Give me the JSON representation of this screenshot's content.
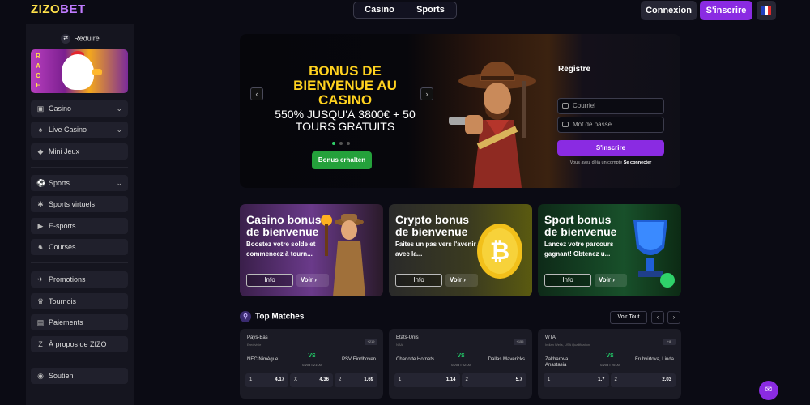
{
  "header": {
    "logo_part1": "ZIZO",
    "logo_part2": "BET",
    "tabs": [
      "Casino",
      "Sports"
    ],
    "login_label": "Connexion",
    "signup_label": "S'inscrire"
  },
  "sidebar": {
    "collapse_label": "Réduire",
    "race_banner_text": "RACE",
    "group1": [
      {
        "label": "Casino",
        "icon": "slot-icon",
        "has_chevron": true
      },
      {
        "label": "Live Casino",
        "icon": "cards-icon",
        "has_chevron": true
      },
      {
        "label": "Mini Jeux",
        "icon": "diamond-icon",
        "has_chevron": false
      }
    ],
    "group2": [
      {
        "label": "Sports",
        "icon": "ball-icon",
        "has_chevron": true
      },
      {
        "label": "Sports virtuels",
        "icon": "virtual-ball-icon",
        "has_chevron": false
      },
      {
        "label": "E-sports",
        "icon": "gamepad-icon",
        "has_chevron": false
      },
      {
        "label": "Courses",
        "icon": "horse-icon",
        "has_chevron": false
      }
    ],
    "group3": [
      {
        "label": "Promotions",
        "icon": "megaphone-icon"
      },
      {
        "label": "Tournois",
        "icon": "trophy-icon"
      },
      {
        "label": "Paiements",
        "icon": "wallet-icon"
      },
      {
        "label": "À propos de ZIZO",
        "icon": "zizo-icon"
      }
    ],
    "support_label": "Soutien"
  },
  "hero": {
    "title": "BONUS DE BIENVENUE AU CASINO",
    "subtitle": "550% JUSQU'À 3800€ + 50 TOURS GRATUITS",
    "button_label": "Bonus erhalten"
  },
  "register": {
    "title": "Registre",
    "email_placeholder": "Courriel",
    "password_placeholder": "Mot de passe",
    "submit_label": "S'inscrire",
    "footer_text": "Vous avez déjà un compte",
    "footer_link": "Se connecter"
  },
  "promos": [
    {
      "title": "Casino bonus de bienvenue",
      "desc": "Boostez votre solde et commencez à tourn...",
      "info": "Info",
      "voir": "Voir"
    },
    {
      "title": "Crypto bonus de bienvenue",
      "desc": "Faites un pas vers l'avenir avec la...",
      "info": "Info",
      "voir": "Voir"
    },
    {
      "title": "Sport bonus de bienvenue",
      "desc": "Lancez votre parcours gagnant! Obtenez u...",
      "info": "Info",
      "voir": "Voir"
    }
  ],
  "matches": {
    "heading": "Top Matches",
    "voir_tout": "Voir Tout",
    "cards": [
      {
        "league": "Pays-Bas",
        "sub": "Eredivisie",
        "badge": "+219",
        "team1": "NEC Nimègue",
        "team2": "PSV Eindhoven",
        "vs": "VS",
        "time": "03/03 • 21:00",
        "odds": [
          {
            "k": "1",
            "v": "4.17"
          },
          {
            "k": "X",
            "v": "4.36"
          },
          {
            "k": "2",
            "v": "1.69"
          }
        ]
      },
      {
        "league": "Etats-Unis",
        "sub": "NBA",
        "badge": "+155",
        "team1": "Charlotte Hornets",
        "team2": "Dallas Mavericks",
        "vs": "VS",
        "time": "04/03 • 02:00",
        "odds": [
          {
            "k": "1",
            "v": "1.14"
          },
          {
            "k": "2",
            "v": "5.7"
          }
        ]
      },
      {
        "league": "WTA",
        "sub": "Indian Wells, USA Qualification",
        "badge": "+8",
        "team1": "Zakharova, Anastasia",
        "team2": "Fruhvirtova, Linda",
        "vs": "VS",
        "time": "03/03 • 20:00",
        "odds": [
          {
            "k": "1",
            "v": "1.7"
          },
          {
            "k": "2",
            "v": "2.03"
          }
        ]
      }
    ]
  },
  "colors": {
    "accent": "#8a2be2",
    "logo_yellow": "#ffe14a",
    "hero_title": "#ffd21f",
    "green": "#24a13b"
  }
}
